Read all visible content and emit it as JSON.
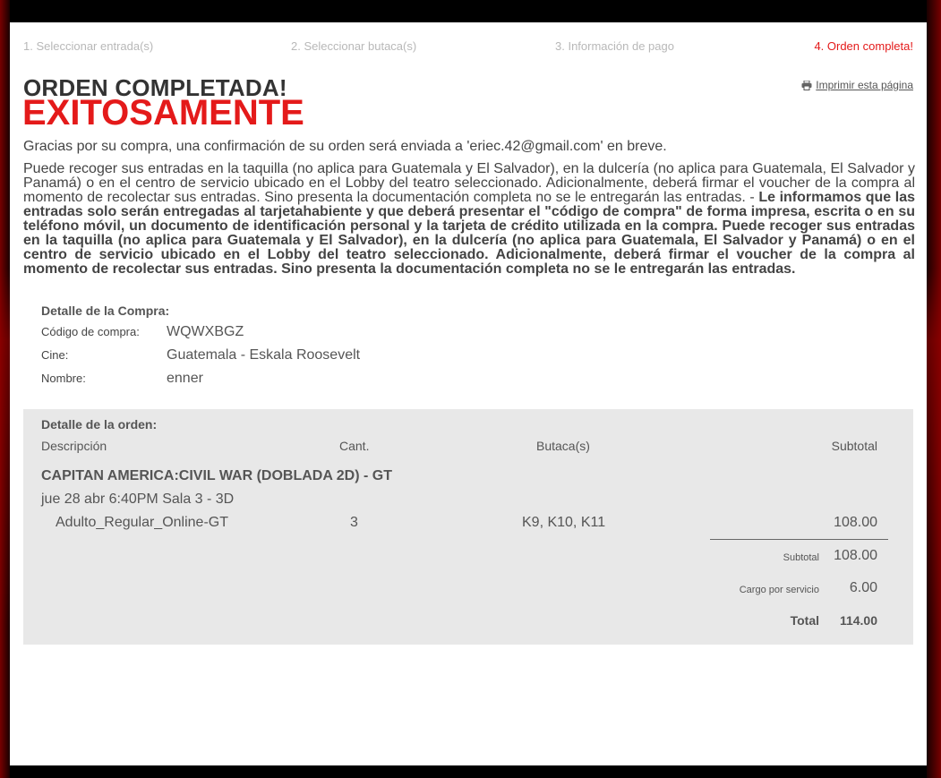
{
  "steps": [
    "1. Seleccionar entrada(s)",
    "2. Seleccionar butaca(s)",
    "3. Información de pago",
    "4. Orden completa!"
  ],
  "print_label": "Imprimir esta página",
  "title_line1": "ORDEN COMPLETADA!",
  "title_line2": "EXITOSAMENTE",
  "thanks_text": "Gracias por su compra, una confirmación de su orden será enviada a 'eriec.42@gmail.com' en breve.",
  "notice": {
    "normal": "Puede recoger sus entradas en la taquilla (no aplica para Guatemala y El Salvador), en la dulcería (no aplica para Guatemala, El Salvador y Panamá) o en el centro de servicio ubicado en el Lobby del teatro seleccionado. Adicionalmente, deberá firmar el voucher de la compra al momento de recolectar sus entradas. Sino presenta la documentación completa no se le entregarán las entradas. - ",
    "bold": "Le informamos que las entradas solo serán entregadas al tarjetahabiente y que deberá presentar el \"código de compra\" de forma impresa, escrita o en su teléfono móvil, un documento de identificación personal y la tarjeta de crédito utilizada en la compra. Puede recoger sus entradas en la taquilla (no aplica para Guatemala y El Salvador), en la dulcería (no aplica para Guatemala, El Salvador y Panamá) o en el centro de servicio ubicado en el Lobby del teatro seleccionado. Adicionalmente, deberá firmar el voucher de la compra al momento de recolectar sus entradas. Sino presenta la documentación completa no se le entregarán las entradas."
  },
  "purchase": {
    "heading": "Detalle de la Compra:",
    "code_label": "Código de compra:",
    "code_value": "WQWXBGZ",
    "cinema_label": "Cine:",
    "cinema_value": "Guatemala - Eskala Roosevelt",
    "name_label": "Nombre:",
    "name_value": "enner"
  },
  "order": {
    "heading": "Detalle de la orden:",
    "col_description": "Descripción",
    "col_qty": "Cant.",
    "col_seats": "Butaca(s)",
    "col_subtotal": "Subtotal",
    "movie": "CAPITAN AMERICA:CIVIL WAR (DOBLADA 2D) - GT",
    "session": "jue 28 abr 6:40PM  Sala 3 - 3D",
    "item": {
      "ticket_type": "Adulto_Regular_Online-GT",
      "qty": "3",
      "seats": "K9, K10, K11",
      "subtotal": "108.00"
    },
    "subtotal_label": "Subtotal",
    "subtotal_value": "108.00",
    "service_label": "Cargo por servicio",
    "service_value": "6.00",
    "total_label": "Total",
    "total_value": "114.00"
  }
}
